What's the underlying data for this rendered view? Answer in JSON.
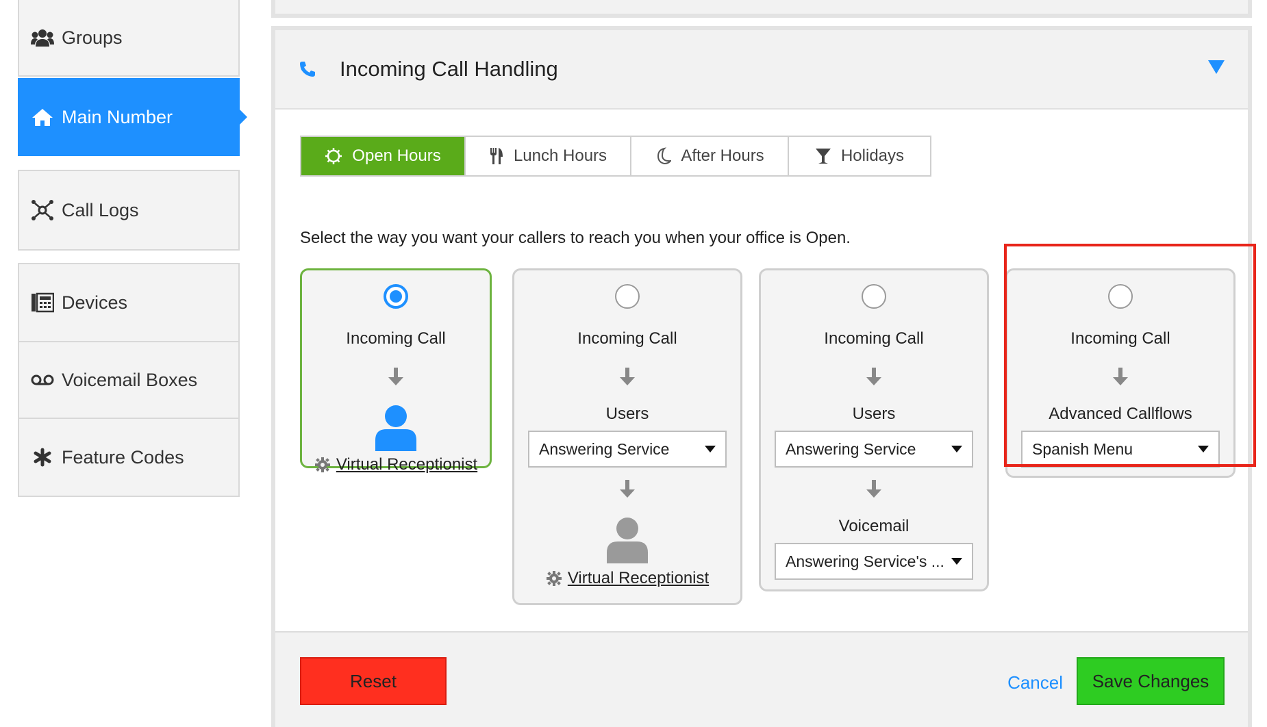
{
  "sidebar": {
    "items": [
      {
        "label": "Groups",
        "icon": "users-icon",
        "active": false
      },
      {
        "label": "Main Number",
        "icon": "home-icon",
        "active": true
      },
      {
        "label": "Call Logs",
        "icon": "network-icon",
        "active": false
      },
      {
        "label": "Devices",
        "icon": "device-icon",
        "active": false
      },
      {
        "label": "Voicemail Boxes",
        "icon": "voicemail-icon",
        "active": false
      },
      {
        "label": "Feature Codes",
        "icon": "asterisk-icon",
        "active": false
      }
    ]
  },
  "panel": {
    "title": "Incoming Call Handling",
    "tabs": [
      {
        "label": "Open Hours",
        "icon": "sun-icon",
        "active": true
      },
      {
        "label": "Lunch Hours",
        "icon": "utensils-icon",
        "active": false
      },
      {
        "label": "After Hours",
        "icon": "moon-icon",
        "active": false
      },
      {
        "label": "Holidays",
        "icon": "glass-icon",
        "active": false
      }
    ],
    "intro": "Select the way you want your callers to reach you when your office is Open.",
    "options": [
      {
        "selected": true,
        "line1": "Incoming Call",
        "link": "Virtual Receptionist"
      },
      {
        "selected": false,
        "line1": "Incoming Call",
        "line2": "Users",
        "select1": "Answering Service",
        "link": "Virtual Receptionist"
      },
      {
        "selected": false,
        "line1": "Incoming Call",
        "line2": "Users",
        "select1": "Answering Service",
        "line3": "Voicemail",
        "select2": "Answering Service's ..."
      },
      {
        "selected": false,
        "line1": "Incoming Call",
        "line2": "Advanced Callflows",
        "select1": "Spanish Menu"
      }
    ]
  },
  "footer": {
    "reset_label": "Reset",
    "cancel_label": "Cancel",
    "save_label": "Save Changes"
  },
  "colors": {
    "accent_blue": "#1e90ff",
    "tab_active_green": "#5aab1a",
    "reset_red": "#ff2f1f",
    "save_green": "#2ecc22",
    "highlight_red": "#e8251a"
  }
}
